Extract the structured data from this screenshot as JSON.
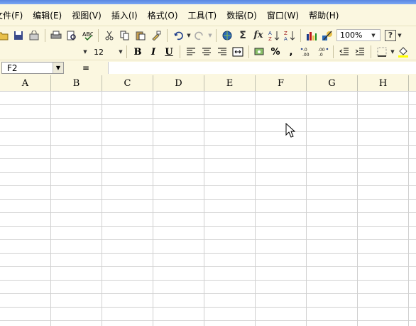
{
  "menu": [
    "文件(F)",
    "编辑(E)",
    "视图(V)",
    "插入(I)",
    "格式(O)",
    "工具(T)",
    "数据(D)",
    "窗口(W)",
    "帮助(H)"
  ],
  "toolbar": {
    "zoom": "100%",
    "help": "?",
    "sigma": "Σ",
    "fx": "fx"
  },
  "format_toolbar": {
    "font_size": "12",
    "bold": "B",
    "italic": "I",
    "underline": "U",
    "percent": "%",
    "comma": ","
  },
  "formula_bar": {
    "name_box": "F2",
    "equals": "="
  },
  "columns": [
    "A",
    "B",
    "C",
    "D",
    "E",
    "F",
    "G",
    "H"
  ]
}
